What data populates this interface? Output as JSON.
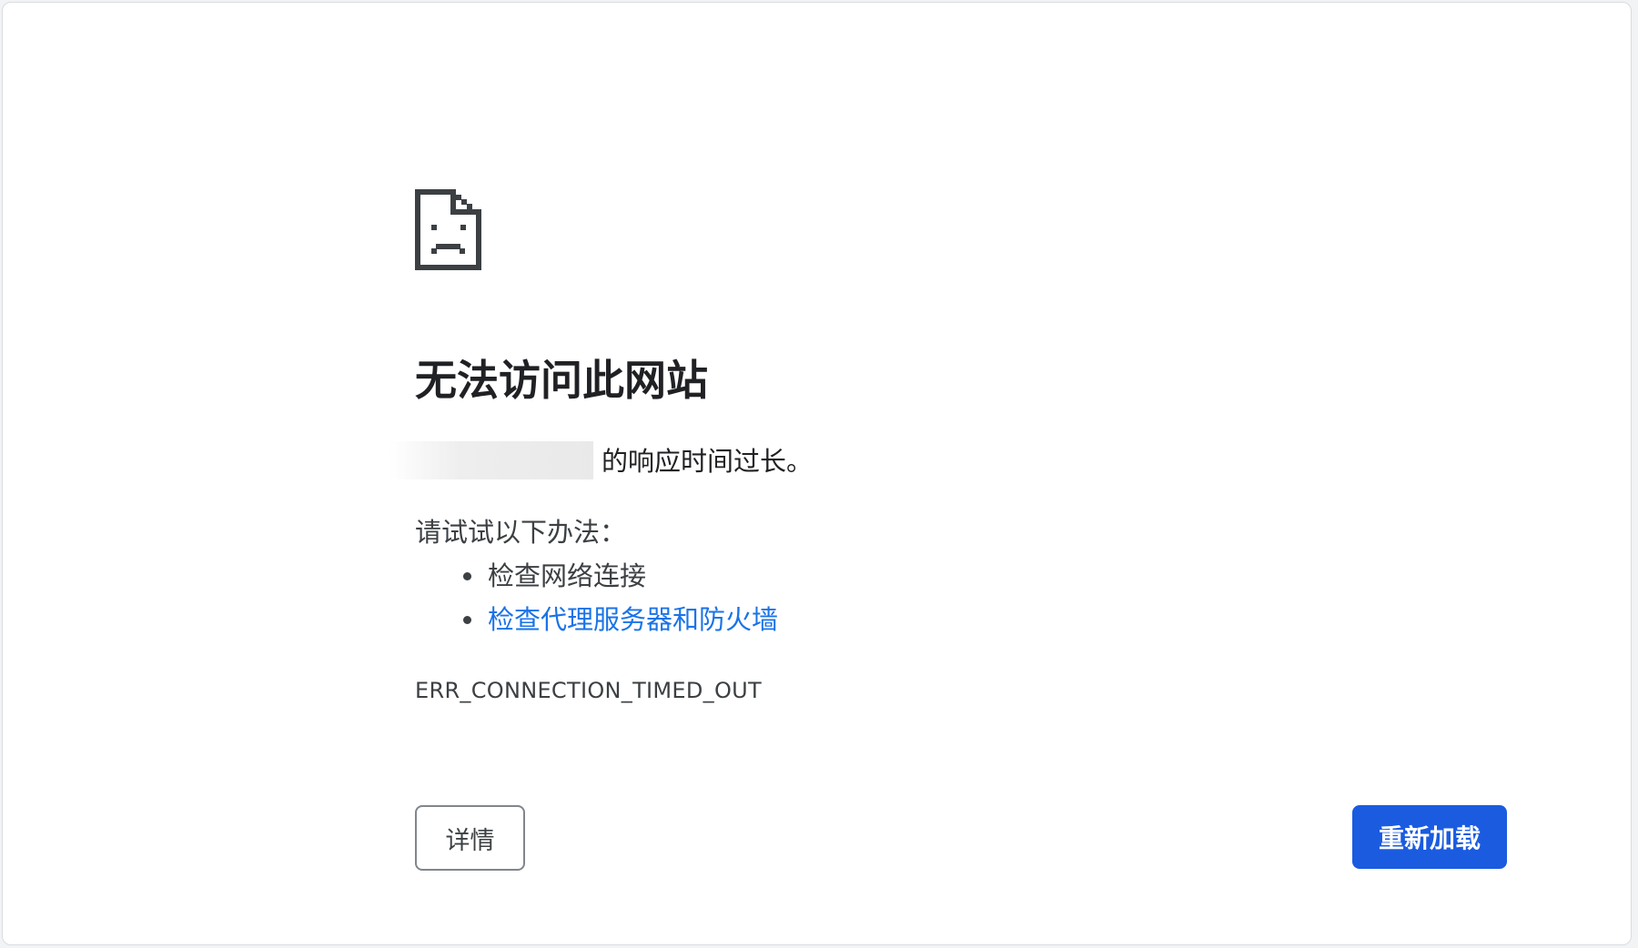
{
  "error_page": {
    "icon": "sad-document-icon",
    "headline": "无法访问此网站",
    "summary_suffix": "的响应时间过长。",
    "suggestions_intro": "请试试以下办法：",
    "suggestions": [
      {
        "label": "检查网络连接",
        "is_link": false
      },
      {
        "label": "检查代理服务器和防火墙",
        "is_link": true
      }
    ],
    "error_code": "ERR_CONNECTION_TIMED_OUT",
    "details_button_label": "详情",
    "reload_button_label": "重新加载"
  },
  "colors": {
    "headline": "#202124",
    "body_text": "#3c4043",
    "link": "#1a73e8",
    "primary_button": "#1a5be0",
    "icon": "#3c4043"
  }
}
